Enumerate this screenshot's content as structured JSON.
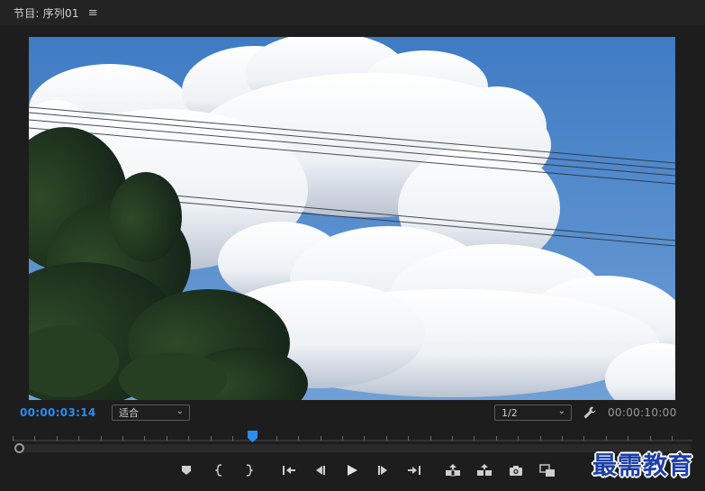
{
  "panel": {
    "title": "节目: 序列01",
    "menu_icon": "hamburger-menu-icon"
  },
  "viewer": {
    "current_timecode": "00:00:03:14",
    "zoom_select": "适合",
    "resolution_select": "1/2",
    "duration_timecode": "00:00:10:00",
    "settings_icon": "wrench-icon",
    "playhead_position": 0.35
  },
  "transport": {
    "buttons": [
      {
        "name": "add-marker-button",
        "icon": "marker-icon"
      },
      {
        "name": "mark-in-button",
        "icon": "mark-in-icon"
      },
      {
        "name": "mark-out-button",
        "icon": "mark-out-icon"
      },
      {
        "name": "go-to-in-button",
        "icon": "go-to-in-icon"
      },
      {
        "name": "step-back-button",
        "icon": "step-back-icon"
      },
      {
        "name": "play-button",
        "icon": "play-icon"
      },
      {
        "name": "step-forward-button",
        "icon": "step-forward-icon"
      },
      {
        "name": "go-to-out-button",
        "icon": "go-to-out-icon"
      },
      {
        "name": "lift-button",
        "icon": "lift-icon"
      },
      {
        "name": "extract-button",
        "icon": "extract-icon"
      },
      {
        "name": "export-frame-button",
        "icon": "camera-icon"
      },
      {
        "name": "compare-view-button",
        "icon": "compare-icon"
      }
    ]
  },
  "watermark": "最需教育",
  "colors": {
    "panel_bg": "#1d1d1d",
    "timecode_accent": "#2d8ceb",
    "playhead": "#2d8ceb",
    "sky": "#4a86c8"
  }
}
